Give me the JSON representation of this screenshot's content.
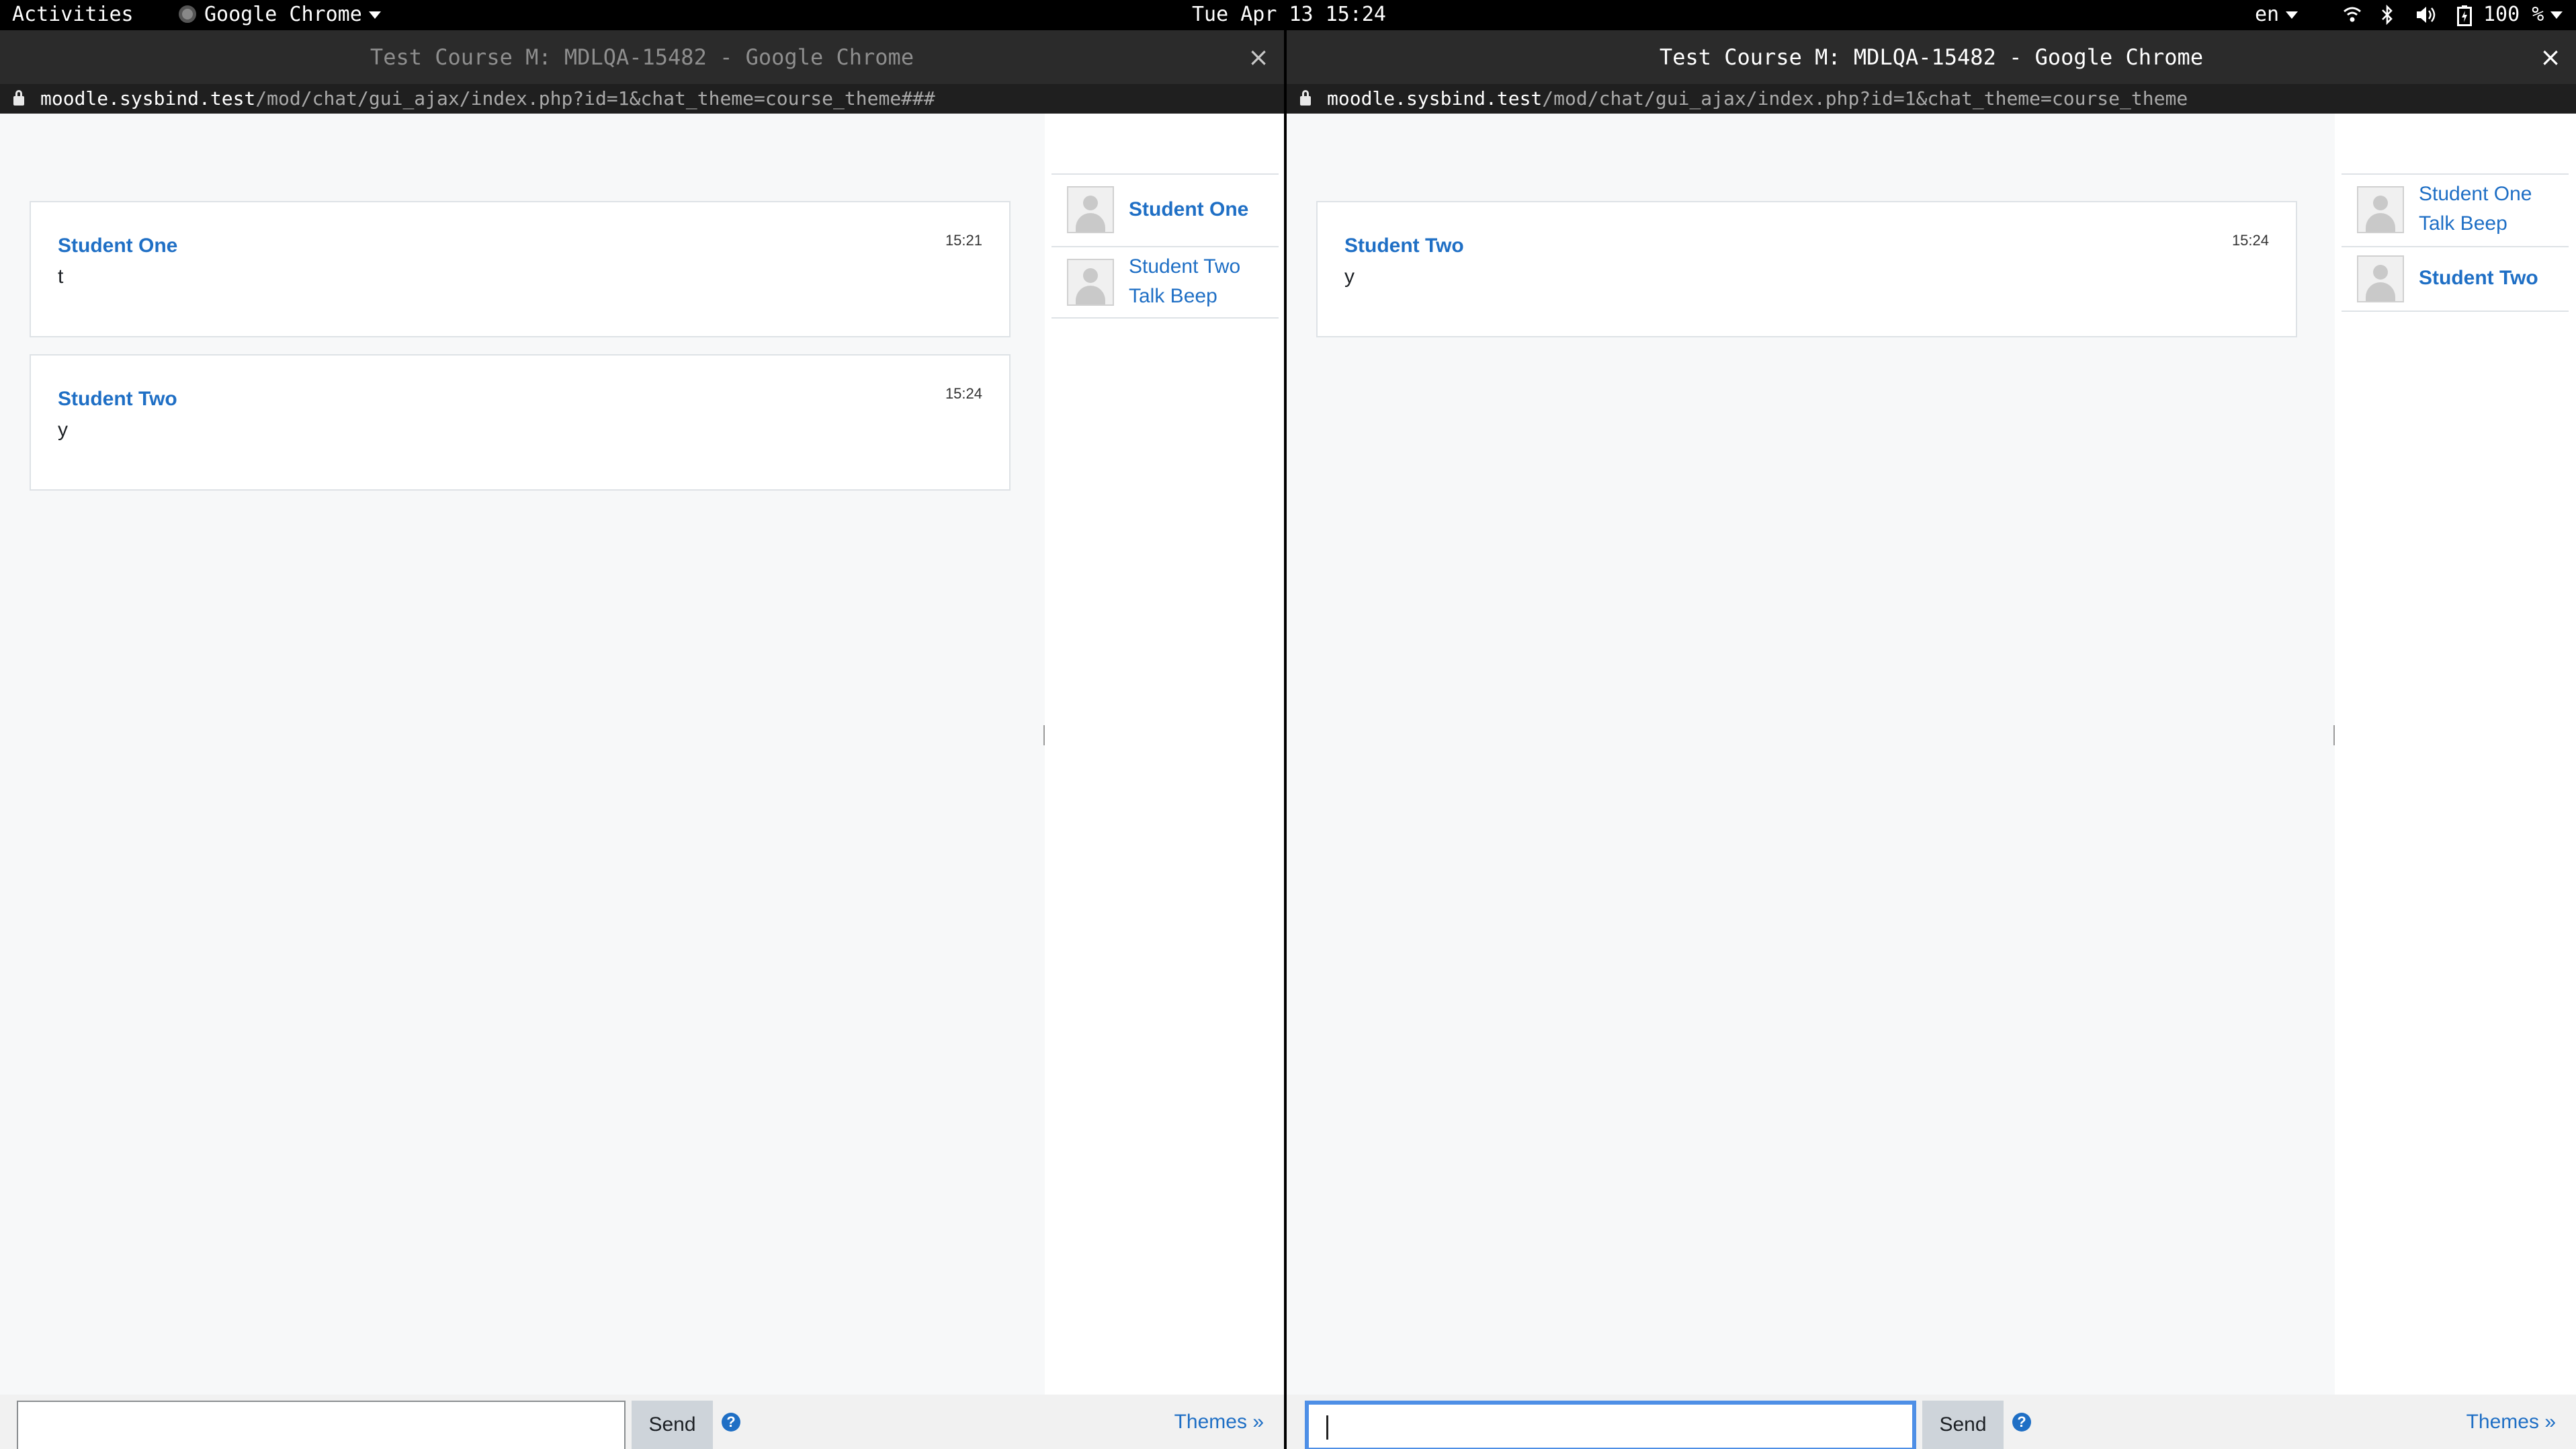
{
  "topbar": {
    "activities": "Activities",
    "app_menu": "Google Chrome",
    "datetime": "Tue Apr 13 15:24",
    "language": "en",
    "battery": "100 %",
    "icons": [
      "wifi-icon",
      "bluetooth-icon",
      "volume-icon",
      "battery-icon"
    ]
  },
  "windows": [
    {
      "title": "Test Course M: MDLQA-15482 - Google Chrome",
      "close": "×",
      "url_host": "moodle.sysbind.test",
      "url_path": "/mod/chat/gui_ajax/index.php?id=1&chat_theme=course_theme###",
      "messages": [
        {
          "author": "Student One",
          "text": "t",
          "time": "15:21"
        },
        {
          "author": "Student Two",
          "text": "y",
          "time": "15:24"
        }
      ],
      "users": [
        {
          "line1": "Student One",
          "line2": ""
        },
        {
          "line1": "Student Two",
          "line2": "Talk Beep"
        }
      ],
      "input_value": "",
      "send_label": "Send",
      "help_glyph": "?",
      "themes_label": "Themes »"
    },
    {
      "title": "Test Course M: MDLQA-15482 - Google Chrome",
      "close": "×",
      "url_host": "moodle.sysbind.test",
      "url_path": "/mod/chat/gui_ajax/index.php?id=1&chat_theme=course_theme",
      "messages": [
        {
          "author": "Student Two",
          "text": "y",
          "time": "15:24"
        }
      ],
      "users": [
        {
          "line1": "Student One",
          "line2": "Talk Beep"
        },
        {
          "line1": "Student Two",
          "line2": ""
        }
      ],
      "input_value": "",
      "send_label": "Send",
      "help_glyph": "?",
      "themes_label": "Themes »"
    }
  ],
  "colors": {
    "link": "#1f6fc5",
    "focus": "#4e8fe6",
    "panel": "#f7f8f9"
  }
}
